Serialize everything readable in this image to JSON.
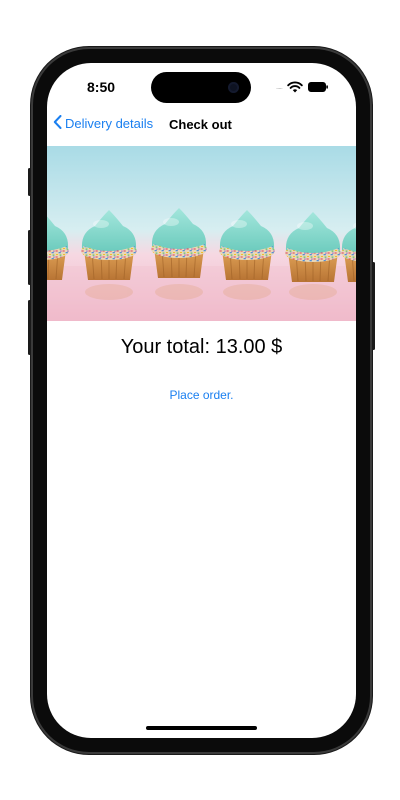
{
  "status_bar": {
    "time": "8:50",
    "signal": "....."
  },
  "nav": {
    "back_label": "Delivery details",
    "title": "Check out"
  },
  "hero": {
    "subject": "Row of cupcakes with mint frosting and sprinkles"
  },
  "checkout": {
    "total_text": "Your total: 13.00 $",
    "place_order_label": "Place order."
  },
  "colors": {
    "accent": "#1a7ff0",
    "frosting": "#7fd6c9",
    "background_top": "#a7dbe5",
    "background_bottom": "#f0b8c8"
  },
  "icons": {
    "back": "chevron-left-icon",
    "wifi": "wifi-icon",
    "battery": "battery-icon"
  }
}
